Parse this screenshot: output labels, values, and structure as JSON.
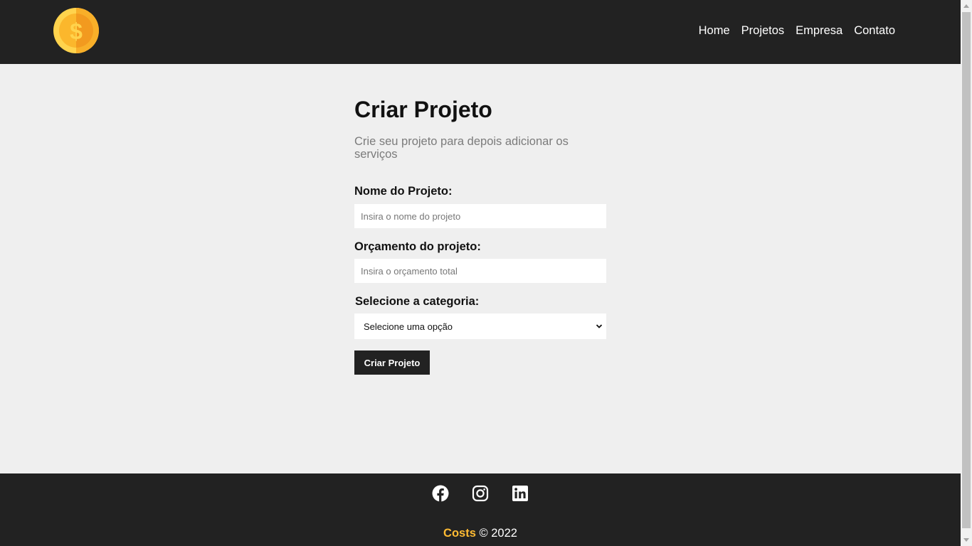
{
  "header": {
    "logo_icon": "dollar-coin-icon",
    "nav": [
      {
        "label": "Home"
      },
      {
        "label": "Projetos"
      },
      {
        "label": "Empresa"
      },
      {
        "label": "Contato"
      }
    ]
  },
  "form": {
    "title": "Criar Projeto",
    "subtitle": "Crie seu projeto para depois adicionar os serviços",
    "name_label": "Nome do Projeto:",
    "name_placeholder": "Insira o nome do projeto",
    "name_value": "",
    "budget_label": "Orçamento do projeto:",
    "budget_placeholder": "Insira o orçamento total",
    "budget_value": "",
    "category_label": "Selecione a categoria:",
    "category_selected": "Selecione uma opção",
    "submit_label": "Criar Projeto"
  },
  "footer": {
    "socials": [
      "facebook-icon",
      "instagram-icon",
      "linkedin-icon"
    ],
    "brand": "Costs",
    "copyright": "© 2022"
  },
  "colors": {
    "nav_bg": "#222222",
    "page_bg": "#efefef",
    "accent": "#ffbb33",
    "button_bg": "#222222"
  }
}
